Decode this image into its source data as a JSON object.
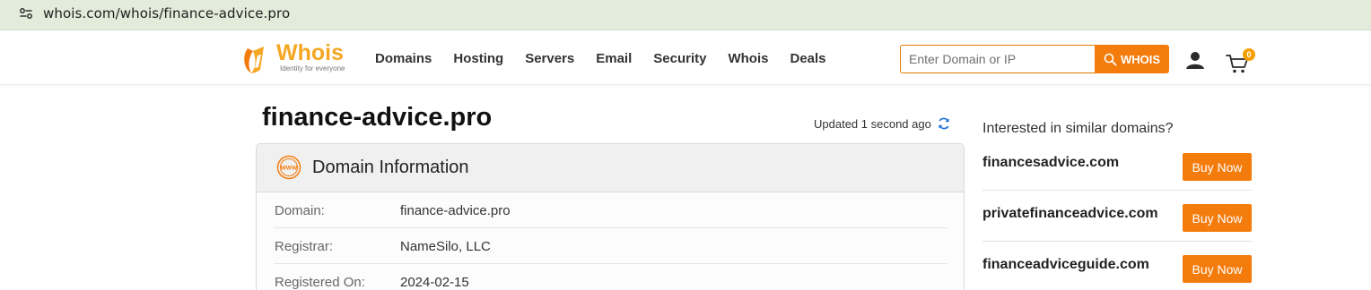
{
  "browser": {
    "url": "whois.com/whois/finance-advice.pro"
  },
  "header": {
    "logo": {
      "word": "Whois",
      "tagline": "Identity for everyone"
    },
    "nav": [
      "Domains",
      "Hosting",
      "Servers",
      "Email",
      "Security",
      "Whois",
      "Deals"
    ],
    "search": {
      "placeholder": "Enter Domain or IP",
      "button_label": "WHOIS"
    },
    "cart_count": "0"
  },
  "main": {
    "domain_title": "finance-advice.pro",
    "updated_text": "Updated 1 second ago",
    "card_title": "Domain Information",
    "rows": [
      {
        "label": "Domain:",
        "value": "finance-advice.pro"
      },
      {
        "label": "Registrar:",
        "value": "NameSilo, LLC"
      },
      {
        "label": "Registered On:",
        "value": "2024-02-15"
      }
    ]
  },
  "sidebar": {
    "title": "Interested in similar domains?",
    "buy_label": "Buy Now",
    "suggestions": [
      "financesadvice.com",
      "privatefinanceadvice.com",
      "financeadviceguide.com"
    ]
  },
  "colors": {
    "accent": "#f47c0d",
    "logo": "#f5a623",
    "address_bar": "#e3ebda",
    "refresh": "#1e73d8"
  }
}
